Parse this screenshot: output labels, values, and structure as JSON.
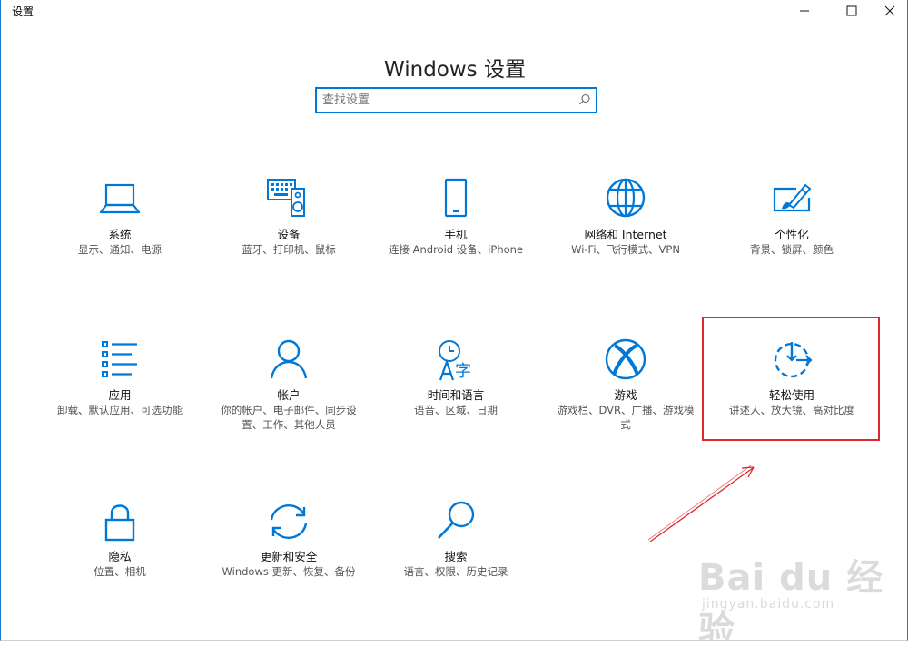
{
  "window": {
    "title": "设置"
  },
  "page": {
    "title": "Windows 设置"
  },
  "search": {
    "placeholder": "查找设置"
  },
  "tiles": [
    {
      "name": "系统",
      "desc": "显示、通知、电源",
      "icon": "laptop-icon"
    },
    {
      "name": "设备",
      "desc": "蓝牙、打印机、鼠标",
      "icon": "devices-icon"
    },
    {
      "name": "手机",
      "desc": "连接 Android 设备、iPhone",
      "icon": "phone-icon"
    },
    {
      "name": "网络和 Internet",
      "desc": "Wi-Fi、飞行模式、VPN",
      "icon": "globe-icon"
    },
    {
      "name": "个性化",
      "desc": "背景、锁屏、颜色",
      "icon": "personalization-icon"
    },
    {
      "name": "应用",
      "desc": "卸载、默认应用、可选功能",
      "icon": "apps-list-icon"
    },
    {
      "name": "帐户",
      "desc": "你的帐户、电子邮件、同步设置、工作、其他人员",
      "icon": "person-icon"
    },
    {
      "name": "时间和语言",
      "desc": "语音、区域、日期",
      "icon": "time-language-icon"
    },
    {
      "name": "游戏",
      "desc": "游戏栏、DVR、广播、游戏模式",
      "icon": "xbox-icon"
    },
    {
      "name": "轻松使用",
      "desc": "讲述人、放大镜、高对比度",
      "icon": "ease-of-access-icon"
    },
    {
      "name": "隐私",
      "desc": "位置、相机",
      "icon": "lock-icon"
    },
    {
      "name": "更新和安全",
      "desc": "Windows 更新、恢复、备份",
      "icon": "sync-icon"
    },
    {
      "name": "搜索",
      "desc": "语言、权限、历史记录",
      "icon": "search-tile-icon"
    }
  ],
  "watermark": {
    "brand": "Bai du 经验",
    "sub": "jingyan.baidu.com"
  },
  "colors": {
    "accent": "#0078d7",
    "annotation": "#e0272c"
  }
}
